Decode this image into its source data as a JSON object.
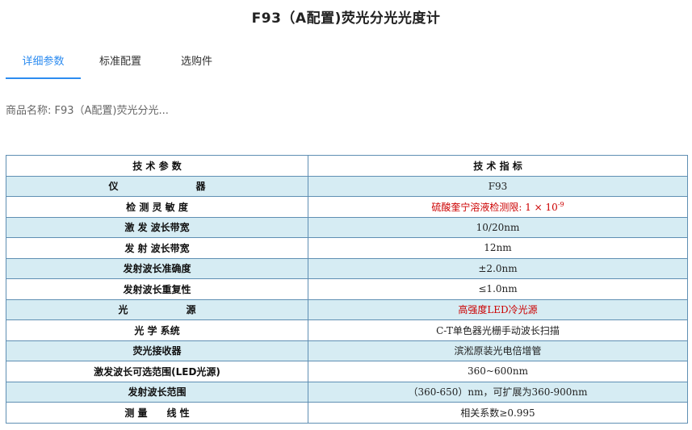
{
  "page": {
    "title": "F93（A配置)荧光分光光度计"
  },
  "tabs": [
    {
      "label": "详细参数",
      "active": true
    },
    {
      "label": "标准配置",
      "active": false
    },
    {
      "label": "选购件",
      "active": false
    }
  ],
  "product": {
    "name_text": "商品名称: F93（A配置)荧光分光..."
  },
  "spec_table": {
    "header": {
      "param": "技 术 参 数",
      "value": "技 术 指 标"
    },
    "rows": [
      {
        "param": "仪　　　　　　　　器",
        "value": "F93"
      },
      {
        "param": "检 测 灵 敏 度",
        "value": "硫酸奎宁溶液检测限: 1 × 10",
        "value_sup": "-9"
      },
      {
        "param": "激 发  波长带宽",
        "value": "10/20nm"
      },
      {
        "param": "发  射  波长带宽",
        "value": "12nm"
      },
      {
        "param": "发射波长准确度",
        "value": "±2.0nm"
      },
      {
        "param": "发射波长重复性",
        "value": "≤1.0nm"
      },
      {
        "param": "光　　　　　　源",
        "value": "高强度LED冷光源"
      },
      {
        "param": "光  学  系统",
        "value": "C-T单色器光栅手动波长扫描"
      },
      {
        "param": "荧光接收器",
        "value": "滨淞原装光电倍增管"
      },
      {
        "param": "激发波长可选范围(LED光源)",
        "value": "360~600nm"
      },
      {
        "param": "发射波长范围",
        "value": "（360-650）nm，可扩展为360-900nm"
      },
      {
        "param": "测  量　　线  性",
        "value": "相关系数≥0.995"
      }
    ]
  },
  "colors": {
    "accent": "#2d8cf0",
    "row_shade": "#d6ecf3",
    "border": "#5f8fb3",
    "highlight_text": "#cc0000"
  }
}
